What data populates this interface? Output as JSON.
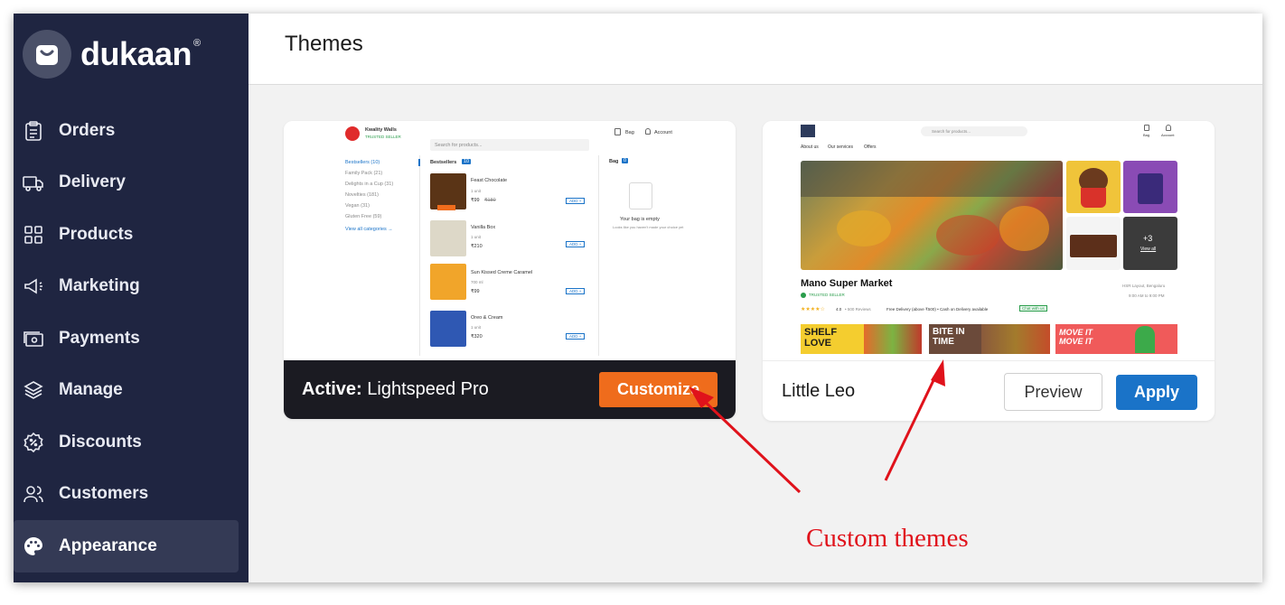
{
  "app": {
    "logo_text": "dukaan",
    "logo_reg": "®"
  },
  "sidebar": {
    "items": [
      {
        "label": "Orders",
        "icon": "clipboard-icon"
      },
      {
        "label": "Delivery",
        "icon": "truck-icon"
      },
      {
        "label": "Products",
        "icon": "grid-icon"
      },
      {
        "label": "Marketing",
        "icon": "megaphone-icon"
      },
      {
        "label": "Payments",
        "icon": "payments-icon"
      },
      {
        "label": "Manage",
        "icon": "layers-icon"
      },
      {
        "label": "Discounts",
        "icon": "discount-icon"
      },
      {
        "label": "Customers",
        "icon": "users-icon"
      },
      {
        "label": "Appearance",
        "icon": "palette-icon",
        "active": true
      }
    ]
  },
  "header": {
    "title": "Themes"
  },
  "themes": [
    {
      "active_prefix": "Active:",
      "name": " Lightspeed Pro",
      "button": "Customize",
      "preview": {
        "store_name": "Kwality Walls",
        "trusted": "TRUSTED SELLER",
        "search_placeholder": "Search for products...",
        "bag": "Bag",
        "account": "Account",
        "categories": [
          "Bestsellers (10)",
          "Family Pack (21)",
          "Delights in a Cup (31)",
          "Novelties (181)",
          "Vegan (31)",
          "Gluten Free (59)"
        ],
        "view_all": "View all categories →",
        "section_title": "Bestsellers",
        "section_count": "10",
        "products": [
          {
            "name": "Feast Chocolate",
            "unit": "1 unit",
            "price": "₹99",
            "old_price": "₹180",
            "add": "ADD +"
          },
          {
            "name": "Vanilla Box",
            "unit": "1 unit",
            "price": "₹210",
            "old_price": "",
            "add": "ADD +"
          },
          {
            "name": "Sun Kissed Creme Caramel",
            "unit": "700 ml",
            "price": "₹99",
            "old_price": "",
            "add": "ADD +"
          },
          {
            "name": "Oreo & Cream",
            "unit": "1 unit",
            "price": "₹320",
            "old_price": "",
            "add": "ADD +"
          }
        ],
        "bag_title": "Bag",
        "bag_count": "0",
        "bag_empty": "Your bag is empty",
        "bag_empty_sub": "Looks like you haven't made your choice yet"
      }
    },
    {
      "name": "Little Leo",
      "preview_button": "Preview",
      "apply_button": "Apply",
      "preview": {
        "search_placeholder": "Search for products...",
        "bag": "Bag",
        "account": "Account",
        "nav": [
          "About us",
          "Our services",
          "Offers"
        ],
        "more": "+3",
        "view_all": "View all",
        "store_name": "Mano Super Market",
        "trusted": "TRUSTED SELLER",
        "location": "HSR Layout, Bengaluru",
        "hours": "9:00 AM to 9:00 PM",
        "rating": "4.0",
        "reviews": "• 500 Reviews",
        "delivery": "Free Delivery (above ₹500) • Cash on Delivery available",
        "chat": "Chat with us",
        "banners": [
          "SHELF LOVE",
          "BITE IN TIME",
          "MOVE IT MOVE IT"
        ]
      }
    }
  ],
  "annotation": {
    "text": "Custom themes",
    "color": "#e0121b"
  },
  "colors": {
    "sidebar_bg": "#1f2541",
    "accent_orange": "#ef6c1c",
    "accent_blue": "#1a73c8"
  }
}
